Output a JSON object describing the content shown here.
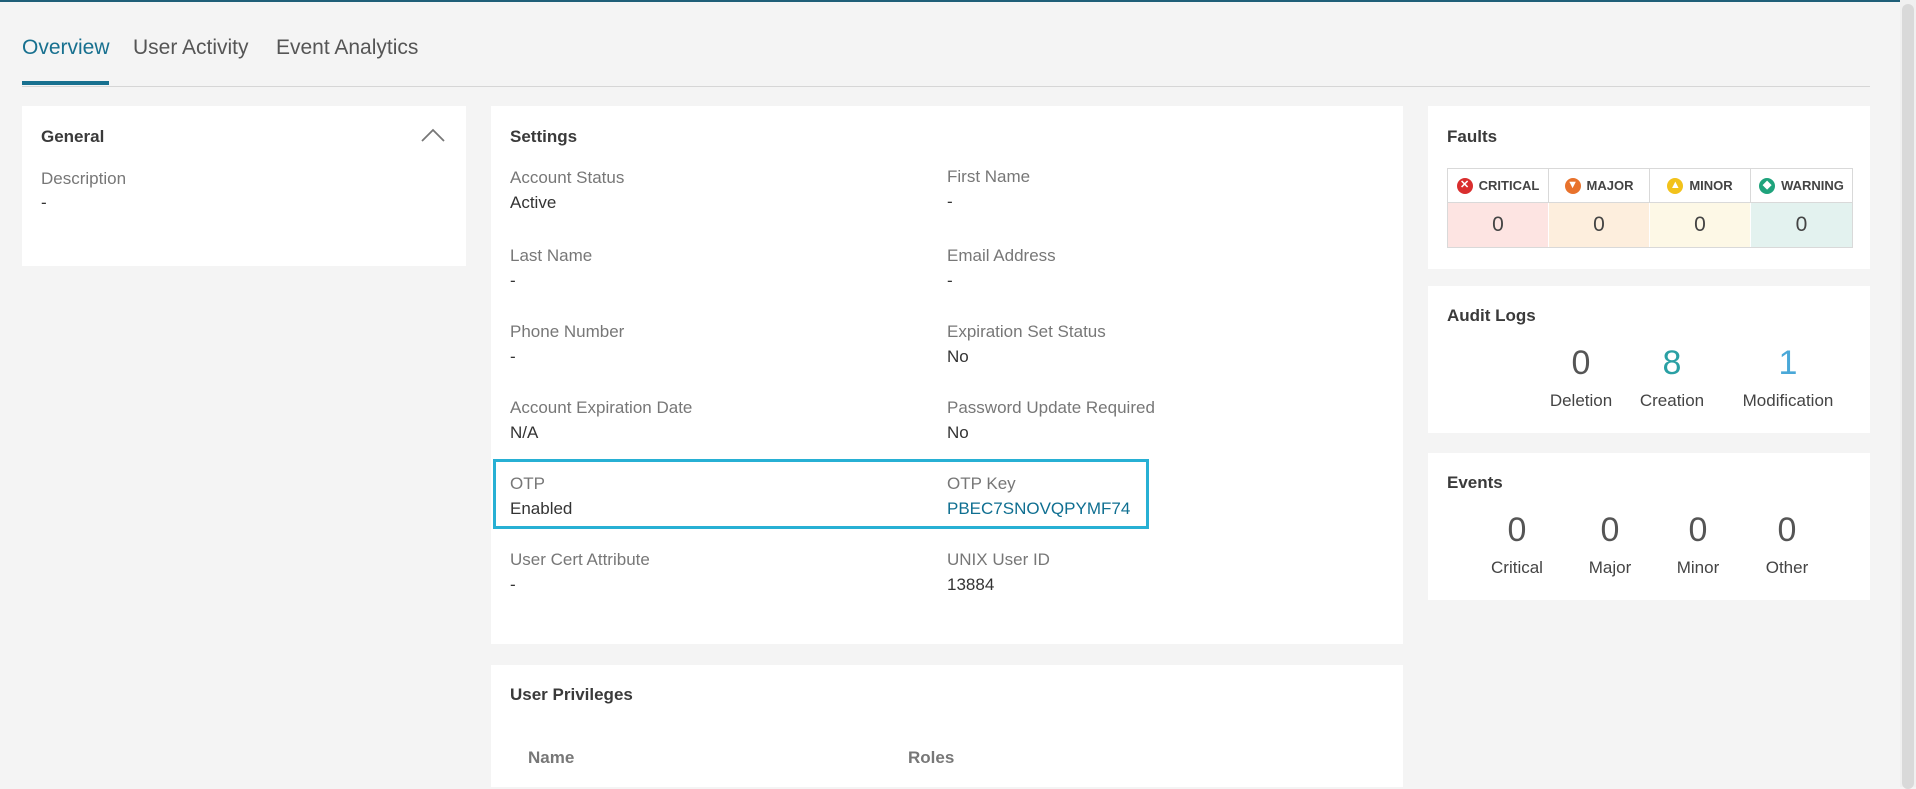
{
  "tabs": [
    {
      "label": "Overview"
    },
    {
      "label": "User Activity"
    },
    {
      "label": "Event Analytics"
    }
  ],
  "general": {
    "title": "General",
    "description_label": "Description",
    "description_value": "-"
  },
  "settings": {
    "title": "Settings",
    "fields": [
      {
        "label": "Account Status",
        "value": "Active"
      },
      {
        "label": "First Name",
        "value": "-"
      },
      {
        "label": "Last Name",
        "value": "-"
      },
      {
        "label": "Email Address",
        "value": "-"
      },
      {
        "label": "Phone Number",
        "value": "-"
      },
      {
        "label": "Expiration Set Status",
        "value": "No"
      },
      {
        "label": "Account Expiration Date",
        "value": "N/A"
      },
      {
        "label": "Password Update Required",
        "value": "No"
      },
      {
        "label": "OTP",
        "value": "Enabled"
      },
      {
        "label": "OTP Key",
        "value": "PBEC7SNOVQPYMF74"
      },
      {
        "label": "User Cert Attribute",
        "value": "-"
      },
      {
        "label": "UNIX User ID",
        "value": "13884"
      }
    ]
  },
  "faults": {
    "title": "Faults",
    "columns": [
      {
        "label": "CRITICAL",
        "value": "0",
        "icon": "critical-icon",
        "color": "#d92e2e"
      },
      {
        "label": "MAJOR",
        "value": "0",
        "icon": "major-icon",
        "color": "#e8722c"
      },
      {
        "label": "MINOR",
        "value": "0",
        "icon": "minor-icon",
        "color": "#f2c21b"
      },
      {
        "label": "WARNING",
        "value": "0",
        "icon": "warning-icon",
        "color": "#1fa37c"
      }
    ]
  },
  "audit_logs": {
    "title": "Audit Logs",
    "stats": [
      {
        "label": "Deletion",
        "value": "0",
        "color": "#555555"
      },
      {
        "label": "Creation",
        "value": "8",
        "color": "#2aa0a4"
      },
      {
        "label": "Modification",
        "value": "1",
        "color": "#4aa8d8"
      }
    ]
  },
  "events": {
    "title": "Events",
    "stats": [
      {
        "label": "Critical",
        "value": "0"
      },
      {
        "label": "Major",
        "value": "0"
      },
      {
        "label": "Minor",
        "value": "0"
      },
      {
        "label": "Other",
        "value": "0"
      }
    ]
  },
  "privileges": {
    "title": "User Privileges",
    "columns": [
      "Name",
      "Roles"
    ]
  }
}
